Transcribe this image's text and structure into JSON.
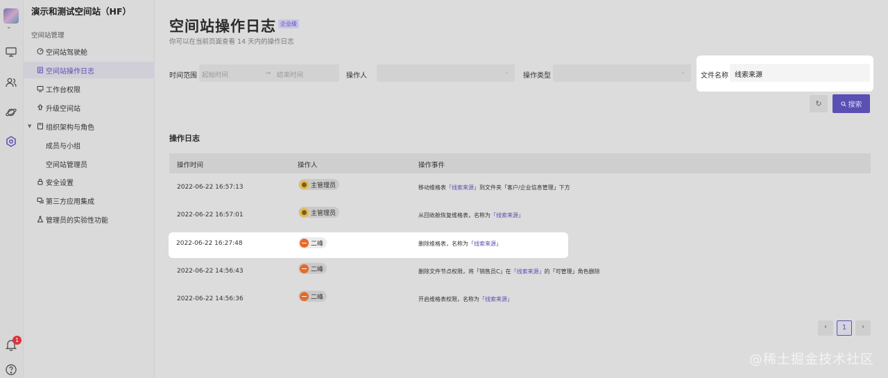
{
  "space": {
    "title": "演示和测试空间站（HF）"
  },
  "sidebar": {
    "section_title": "空间站管理",
    "items": [
      {
        "label": "空间站驾驶舱",
        "icon": "gauge-icon"
      },
      {
        "label": "空间站操作日志",
        "icon": "log-icon",
        "active": true
      },
      {
        "label": "工作台权限",
        "icon": "workbench-icon"
      },
      {
        "label": "升级空间站",
        "icon": "upgrade-icon"
      },
      {
        "label": "组织架构与角色",
        "icon": "org-icon",
        "expanded": true
      },
      {
        "label": "成员与小组",
        "sub": true
      },
      {
        "label": "空间站管理员",
        "sub": true
      },
      {
        "label": "安全设置",
        "icon": "lock-icon"
      },
      {
        "label": "第三方应用集成",
        "icon": "integration-icon"
      },
      {
        "label": "管理员的实验性功能",
        "icon": "flask-icon"
      }
    ]
  },
  "rail": {
    "notification_count": "1"
  },
  "header": {
    "title": "空间站操作日志",
    "tier": "企业级",
    "subtitle": "你可以在当前页面查看 14 天内的操作日志"
  },
  "filters": {
    "time_range_label": "时间范围",
    "start_placeholder": "起始时间",
    "range_arrow": "→",
    "end_placeholder": "结束时间",
    "operator_label": "操作人",
    "op_type_label": "操作类型",
    "file_name_label": "文件名称",
    "file_name_value": "线索来源",
    "search_label": "搜索"
  },
  "log": {
    "title": "操作日志",
    "columns": [
      "操作时间",
      "操作人",
      "操作事件"
    ],
    "rows": [
      {
        "time": "2022-06-22 16:57:13",
        "operator": "主管理员",
        "avatar": "admin",
        "pre": "移动维格表",
        "link": "「线索来源」",
        "post": "到文件夹「客户/企业信息管理」下方"
      },
      {
        "time": "2022-06-22 16:57:01",
        "operator": "主管理员",
        "avatar": "admin",
        "pre": "从回收舱恢复维格表，名称为",
        "link": "「线索来源」",
        "post": ""
      },
      {
        "time": "2022-06-22 16:27:48",
        "operator": "二峰",
        "avatar": "erfeng",
        "pre": "删除维格表，名称为",
        "link": "「线索来源」",
        "post": "",
        "highlight": true
      },
      {
        "time": "2022-06-22 14:56:43",
        "operator": "二峰",
        "avatar": "erfeng",
        "pre": "删除文件节点权限，将「销售员C」在",
        "link": "「线索来源」",
        "post": "的「可管理」角色删除"
      },
      {
        "time": "2022-06-22 14:56:36",
        "operator": "二峰",
        "avatar": "erfeng",
        "pre": "开启维格表权限，名称为",
        "link": "「线索来源」",
        "post": ""
      }
    ]
  },
  "pagination": {
    "prev": "‹",
    "current": "1",
    "next": "›"
  },
  "watermark": "@稀土掘金技术社区",
  "colors": {
    "accent": "#5a4fb3",
    "badge": "#d9363e"
  }
}
